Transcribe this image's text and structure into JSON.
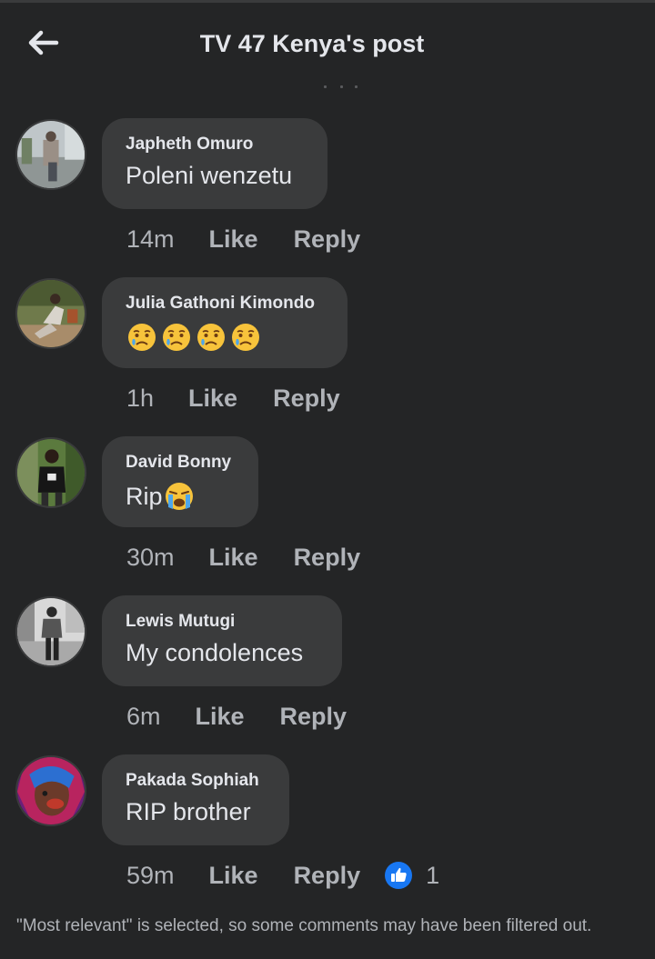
{
  "header": {
    "title": "TV 47 Kenya's post",
    "back_icon": "arrow-left-icon"
  },
  "comments": [
    {
      "author": "Japheth Omuro",
      "text": "Poleni wenzetu",
      "time": "14m",
      "like": "Like",
      "reply": "Reply"
    },
    {
      "author": "Julia Gathoni Kimondo",
      "text": "",
      "emojis": [
        "sad-tear-face",
        "sad-tear-face",
        "sad-tear-face",
        "sad-tear-face"
      ],
      "time": "1h",
      "like": "Like",
      "reply": "Reply"
    },
    {
      "author": "David Bonny",
      "text": "Rip",
      "emojis": [
        "loudly-crying-face"
      ],
      "time": "30m",
      "like": "Like",
      "reply": "Reply"
    },
    {
      "author": "Lewis Mutugi",
      "text": "My condolences",
      "time": "6m",
      "like": "Like",
      "reply": "Reply"
    },
    {
      "author": "Pakada Sophiah",
      "text": "RIP brother",
      "time": "59m",
      "like": "Like",
      "reply": "Reply",
      "reaction_icon": "thumbs-up-icon",
      "reaction_count": "1"
    }
  ],
  "footer": {
    "note": "\"Most relevant\" is selected, so some comments may have been filtered out."
  },
  "colors": {
    "background": "#242526",
    "bubble": "#3a3b3c",
    "text_primary": "#e4e6eb",
    "text_secondary": "#b0b3b8",
    "like_blue": "#1877f2",
    "emoji_yellow": "#f7c33b"
  }
}
